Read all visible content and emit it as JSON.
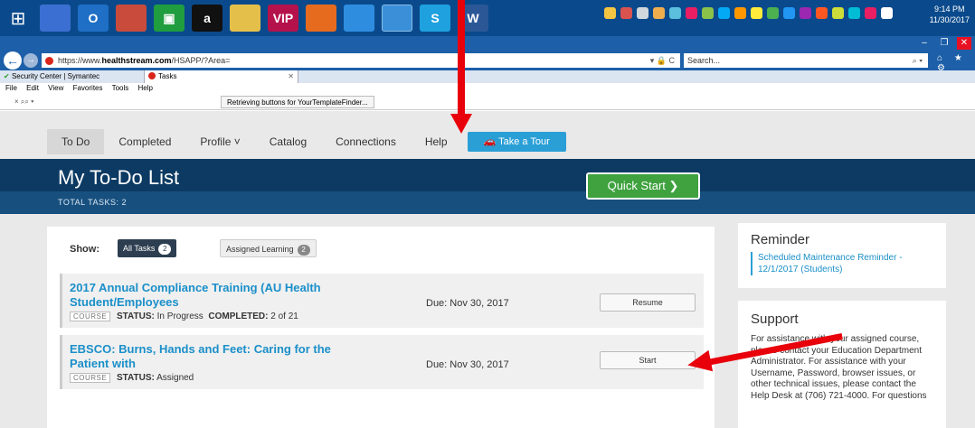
{
  "taskbar": {
    "apps": [
      {
        "label": "",
        "color": "#3b6fd1"
      },
      {
        "label": "O",
        "color": "#1e6fc5"
      },
      {
        "label": "",
        "color": "#c94b3c"
      },
      {
        "label": "▣",
        "color": "#1f9d3f"
      },
      {
        "label": "a",
        "color": "#111111"
      },
      {
        "label": "",
        "color": "#e4c04a"
      },
      {
        "label": "VIP",
        "color": "#b5124b"
      },
      {
        "label": "",
        "color": "#e66b1f"
      },
      {
        "label": "",
        "color": "#2f8de0"
      },
      {
        "label": "",
        "color": "#3a8fd8"
      },
      {
        "label": "S",
        "color": "#1fa1e0"
      },
      {
        "label": "W",
        "color": "#2b5797"
      }
    ],
    "tray_colors": [
      "#f4c542",
      "#d9534f",
      "#cfd8dc",
      "#f0ad4e",
      "#5bc0de",
      "#e91e63",
      "#8bc34a",
      "#03a9f4",
      "#ff9800",
      "#ffeb3b",
      "#4caf50",
      "#2196f3",
      "#9c27b0",
      "#ff5722",
      "#cddc39",
      "#00bcd4",
      "#e91e63",
      "#ffffff"
    ],
    "clock_time": "9:14 PM",
    "clock_date": "11/30/2017"
  },
  "browser": {
    "url_prefix": "https://www.",
    "url_domain": "healthstream.com",
    "url_path": "/HSAPP/?Area=",
    "address_tools": "▾ 🔒 C",
    "search_placeholder": "Search...",
    "search_icon": "⌕ ▾",
    "nav_icons": "⌂ ★ ⚙",
    "tabs": [
      {
        "label": "Security Center | Symantec"
      },
      {
        "label": "Tasks"
      }
    ],
    "menu": [
      "File",
      "Edit",
      "View",
      "Favorites",
      "Tools",
      "Help"
    ],
    "toolbar_icons": "× ⌕⌕ ▾",
    "status": "Retrieving buttons for YourTemplateFinder..."
  },
  "site": {
    "nav": {
      "todo": "To Do",
      "completed": "Completed",
      "profile": "Profile ˅",
      "catalog": "Catalog",
      "connections": "Connections",
      "help": "Help",
      "tour": "🚗 Take a Tour"
    },
    "hero": {
      "title": "My To-Do List",
      "total": "TOTAL TASKS:  2",
      "quick_start": "Quick Start ❯"
    },
    "filters": {
      "show_label": "Show:",
      "all_tasks": "All Tasks",
      "all_count": "2",
      "assigned": "Assigned Learning",
      "assigned_count": "2"
    },
    "tasks": [
      {
        "title": "2017 Annual Compliance Training (AU Health Student/Employees",
        "badge": "COURSE",
        "status_label": "STATUS:",
        "status": "In Progress",
        "completed_label": "COMPLETED:",
        "completed": "2 of 21",
        "due": "Due: Nov 30, 2017",
        "button": "Resume"
      },
      {
        "title": "EBSCO: Burns, Hands and Feet: Caring for the Patient with",
        "badge": "COURSE",
        "status_label": "STATUS:",
        "status": "Assigned",
        "due": "Due: Nov 30, 2017",
        "button": "Start"
      }
    ],
    "reminder": {
      "title": "Reminder",
      "link": "Scheduled Maintenance Reminder - 12/1/2017 (Students)"
    },
    "support": {
      "title": "Support",
      "text": "For assistance with your assigned course, please contact your Education Department Administrator. For assistance with your Username, Password, browser issues, or other technical issues, please contact the Help Desk at (706) 721-4000. For questions"
    }
  },
  "annotation_color": "#e8000b"
}
